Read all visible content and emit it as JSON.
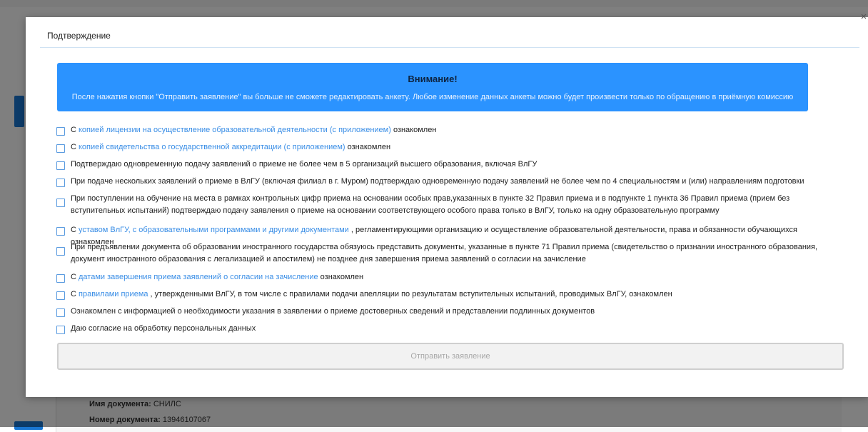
{
  "modal": {
    "title": "Подтверждение",
    "close_glyph": "×",
    "alert": {
      "title": "Внимание!",
      "text": "После нажатия кнопки \"Отправить заявление\" вы больше не сможете редактировать анкету. Любое изменение данных анкеты можно будет произвести только по обращению в приёмную комиссию",
      "color": "#2b93ff"
    },
    "checkboxes": [
      {
        "pre": "С ",
        "link": "копией лицензии на осуществление образовательной деятельности (с приложением)",
        "post": " ознакомлен",
        "checked": false
      },
      {
        "pre": "С ",
        "link": "копией свидетельства о государственной аккредитации (с приложением)",
        "post": " ознакомлен",
        "checked": false
      },
      {
        "pre": "Подтверждаю одновременную подачу заявлений о приеме не более чем в 5 организаций высшего образования, включая ВлГУ",
        "link": "",
        "post": "",
        "checked": false
      },
      {
        "pre": "При подаче нескольких заявлений о приеме в ВлГУ (включая филиал в г. Муром) подтверждаю одновременную подачу заявлений не более чем по 4 специальностям и (или) направлениям подготовки",
        "link": "",
        "post": "",
        "checked": false
      },
      {
        "pre": "При поступлении на обучение на места в рамках контрольных цифр приема на основании особых прав,указанных в пункте 32 Правил приема и в подпункте 1 пункта 36 Правил приема (прием без вступительных испытаний) подтверждаю подачу заявления о приеме на основании соответствующего особого права только в ВлГУ, только на одну образовательную программу",
        "link": "",
        "post": "",
        "checked": false
      },
      {
        "pre": "С ",
        "link": "уставом ВлГУ, с образовательными программами и другими документами",
        "post": " , регламентирующими организацию и осуществление образовательной деятельности, права и обязанности обучающихся ознакомлен",
        "checked": false
      },
      {
        "pre": "При предъявлении документа об образовании иностранного государства обязуюсь представить документы, указанные в пункте 71 Правил приема (свидетельство о признании иностранного образования, документ иностранного образования с легализацией и апостилем) не позднее дня завершения приема заявлений о согласии на зачисление",
        "link": "",
        "post": "",
        "checked": false
      },
      {
        "pre": "С ",
        "link": "датами завершения приема заявлений о согласии на зачисление",
        "post": " ознакомлен",
        "checked": false
      },
      {
        "pre": "С ",
        "link": "правилами приема",
        "post": " , утвержденными ВлГУ, в том числе с правилами подачи апелляции по результатам вступительных испытаний, проводимых ВлГУ, ознакомлен",
        "checked": false
      },
      {
        "pre": "Ознакомлен с информацией о необходимости указания в заявлении о приеме достоверных сведений и представлении подлинных документов",
        "link": "",
        "post": "",
        "checked": false
      },
      {
        "pre": "Даю согласие на обработку персональных данных",
        "link": "",
        "post": "",
        "checked": false
      }
    ],
    "submit_label": "Отправить заявление"
  },
  "background": {
    "doc_name_label": "Имя документа:",
    "doc_name_value": "СНИЛС",
    "doc_number_label": "Номер документа:",
    "doc_number_value": "13946107067"
  }
}
